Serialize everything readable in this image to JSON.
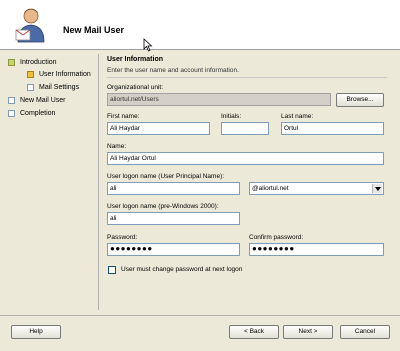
{
  "header": {
    "title": "New Mail User"
  },
  "nav": {
    "items": [
      {
        "label": "Introduction"
      },
      {
        "label": "User Information"
      },
      {
        "label": "Mail Settings"
      },
      {
        "label": "New Mail User"
      },
      {
        "label": "Completion"
      }
    ]
  },
  "section": {
    "title": "User Information",
    "subtitle": "Enter the user name and account information."
  },
  "form": {
    "org_unit_label": "Organizational unit:",
    "org_unit_value": "aliortul.net/Users",
    "browse_label": "Browse...",
    "first_name_label": "First name:",
    "first_name_value": "Ali Haydar",
    "initials_label": "Initials:",
    "initials_value": "",
    "last_name_label": "Last name:",
    "last_name_value": "Ortul",
    "name_label": "Name:",
    "name_value": "Ali Haydar Ortul",
    "upn_label": "User logon name (User Principal Name):",
    "upn_value": "ali",
    "upn_domain": "@aliortul.net",
    "pre2000_label": "User logon name (pre-Windows 2000):",
    "pre2000_value": "ali",
    "password_label": "Password:",
    "password_value": "●●●●●●●●",
    "confirm_label": "Confirm password:",
    "confirm_value": "●●●●●●●●",
    "must_change_label": "User must change password at next logon"
  },
  "footer": {
    "help": "Help",
    "back": "< Back",
    "next": "Next >",
    "cancel": "Cancel"
  }
}
